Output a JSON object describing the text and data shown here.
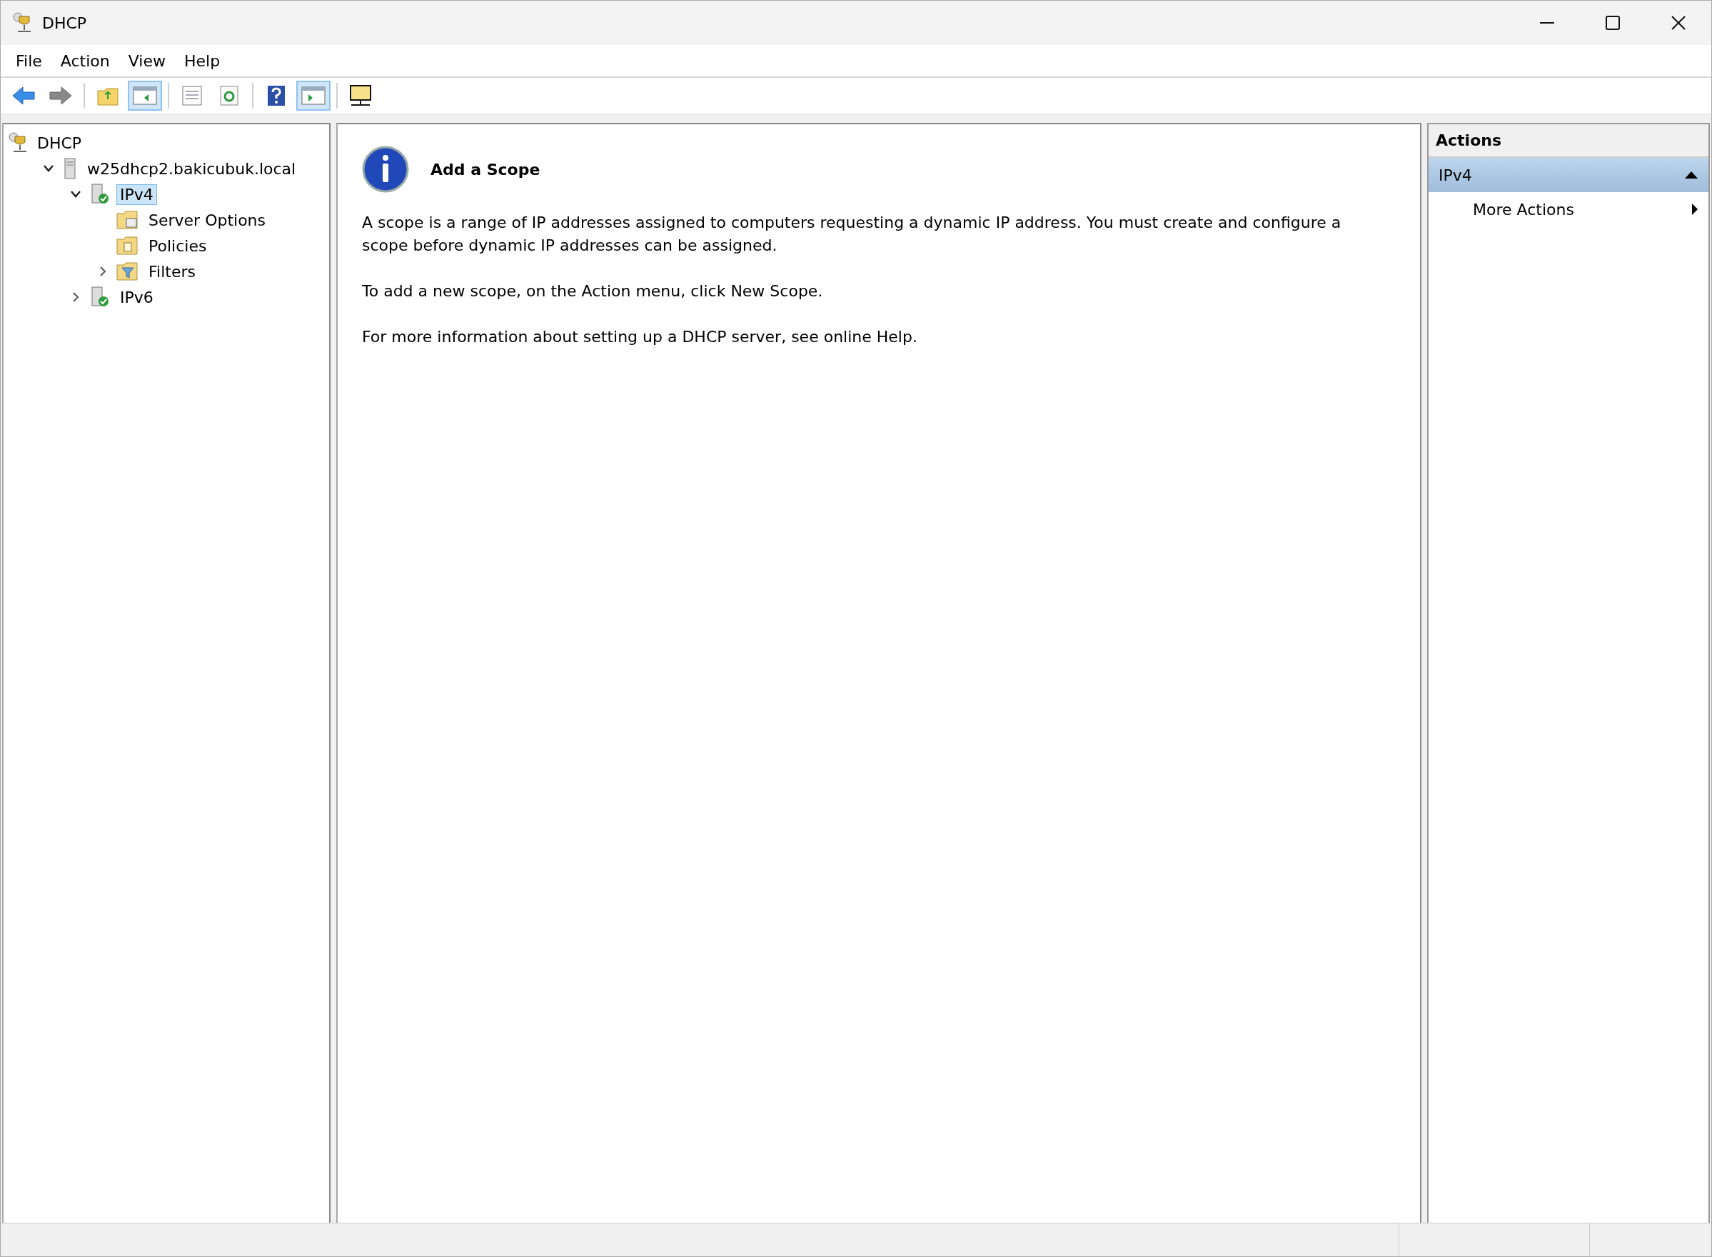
{
  "window": {
    "title": "DHCP"
  },
  "menu": [
    "File",
    "Action",
    "View",
    "Help"
  ],
  "toolbar": [
    {
      "kind": "back",
      "pressed": false
    },
    {
      "kind": "forward",
      "pressed": false
    },
    {
      "kind": "separator"
    },
    {
      "kind": "up-folder",
      "pressed": false
    },
    {
      "kind": "tree-pane",
      "pressed": true
    },
    {
      "kind": "separator"
    },
    {
      "kind": "properties",
      "pressed": false
    },
    {
      "kind": "refresh",
      "pressed": false
    },
    {
      "kind": "separator"
    },
    {
      "kind": "help",
      "pressed": false
    },
    {
      "kind": "action-pane",
      "pressed": true
    },
    {
      "kind": "separator"
    },
    {
      "kind": "monitor",
      "pressed": false
    }
  ],
  "tree": [
    {
      "label": "DHCP",
      "kind": "dhcp",
      "selected": false,
      "children": [
        {
          "label": "w25dhcp2.bakicubuk.local",
          "kind": "server",
          "expandable": true,
          "expanded": true,
          "selected": false,
          "children": [
            {
              "label": "IPv4",
              "kind": "protocol",
              "expandable": true,
              "expanded": true,
              "selected": true,
              "children": [
                {
                  "label": "Server Options",
                  "kind": "options",
                  "selected": false
                },
                {
                  "label": "Policies",
                  "kind": "policies",
                  "selected": false
                },
                {
                  "label": "Filters",
                  "kind": "filters",
                  "expandable": true,
                  "expanded": false,
                  "selected": false
                }
              ]
            },
            {
              "label": "IPv6",
              "kind": "protocol",
              "expandable": true,
              "expanded": false,
              "selected": false
            }
          ]
        }
      ]
    }
  ],
  "content": {
    "title": "Add a Scope",
    "paragraphs": [
      "A scope is a range of IP addresses assigned to computers requesting a dynamic IP address. You must create and configure a scope before dynamic IP addresses can be assigned.",
      "To add a new scope, on the Action menu, click New Scope.",
      "For more information about setting up a DHCP server, see online Help."
    ]
  },
  "actions": {
    "title": "Actions",
    "sections": [
      {
        "label": "IPv4",
        "expanded": true,
        "items": [
          {
            "label": "More Actions",
            "submenu": true
          }
        ]
      }
    ]
  }
}
